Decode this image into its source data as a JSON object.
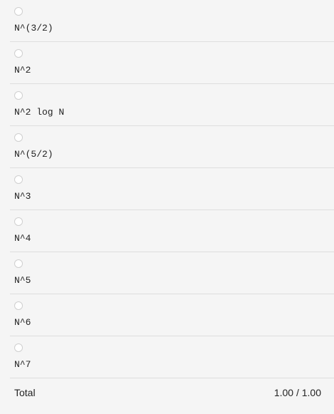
{
  "options": [
    {
      "label": "N^(3/2)"
    },
    {
      "label": "N^2"
    },
    {
      "label": "N^2 log N"
    },
    {
      "label": "N^(5/2)"
    },
    {
      "label": "N^3"
    },
    {
      "label": "N^4"
    },
    {
      "label": "N^5"
    },
    {
      "label": "N^6"
    },
    {
      "label": "N^7"
    }
  ],
  "total": {
    "label": "Total",
    "value": "1.00 / 1.00"
  }
}
